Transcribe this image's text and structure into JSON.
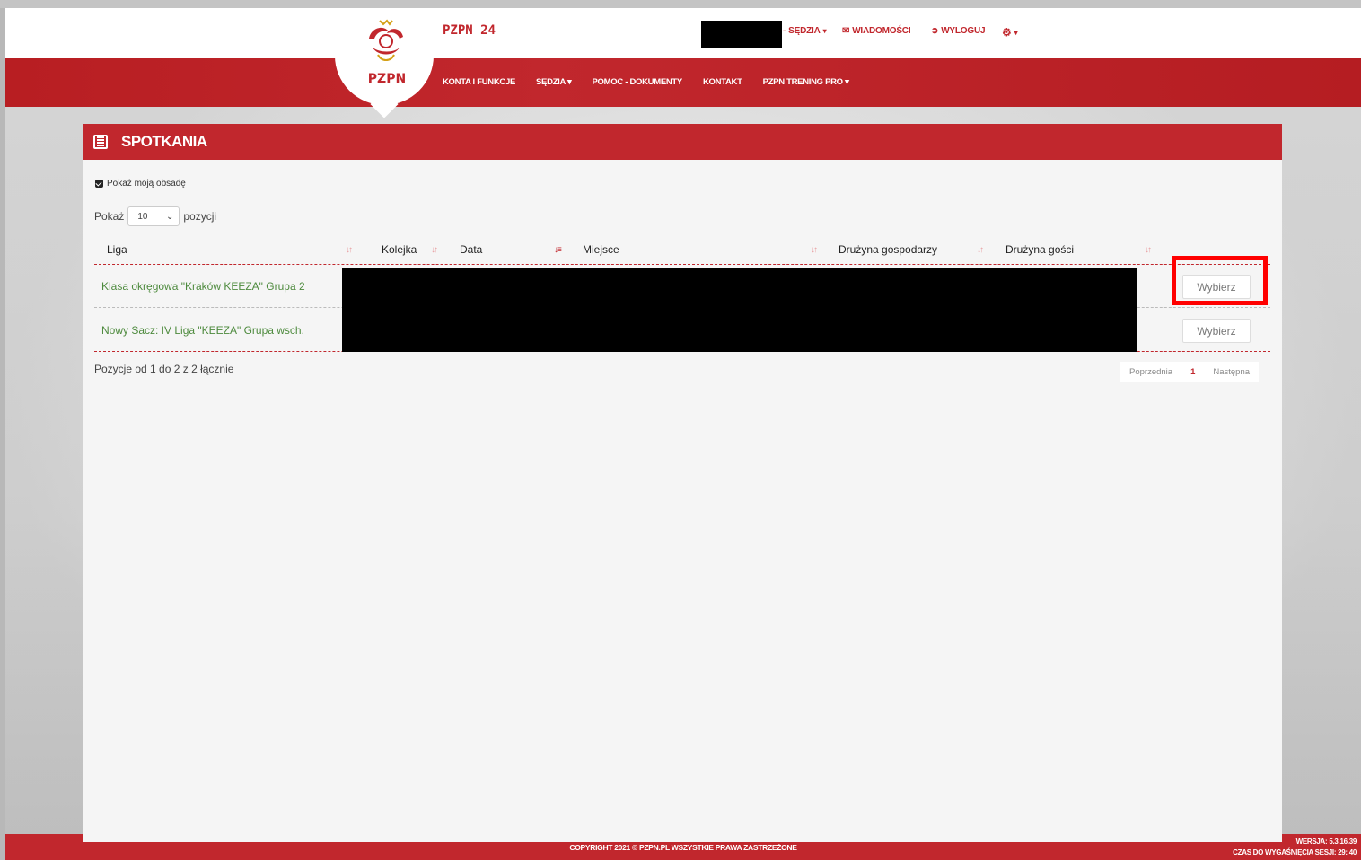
{
  "header": {
    "logo_text": "PZPN",
    "app_title": "PZPN 24",
    "top_nav": [
      {
        "label": "SĘDZIA",
        "icon": "caret-down-icon"
      },
      {
        "label": "WIADOMOŚCI",
        "icon": "envelope-icon"
      },
      {
        "label": "WYLOGUJ",
        "icon": "logout-icon"
      }
    ],
    "main_nav": [
      "KONTA I FUNKCJE",
      "SĘDZIA",
      "POMOC - DOKUMENTY",
      "KONTAKT",
      "PZPN TRENING PRO"
    ]
  },
  "panel": {
    "title": "SPOTKANIA",
    "checkbox_label": "Pokaż moją obsadę",
    "show_prefix": "Pokaż",
    "show_value": "10",
    "show_suffix": "pozycji",
    "columns": [
      "Liga",
      "Kolejka",
      "Data",
      "Miejsce",
      "Drużyna gospodarzy",
      "Drużyna gości"
    ],
    "rows": [
      {
        "league": "Klasa okręgowa \"Kraków KEEZA\" Grupa 2",
        "action": "Wybierz"
      },
      {
        "league": "Nowy Sacz: IV Liga \"KEEZA\" Grupa wsch.",
        "action": "Wybierz"
      }
    ],
    "info": "Pozycje od 1 do 2 z 2 łącznie",
    "pager": {
      "prev": "Poprzednia",
      "current": "1",
      "next": "Następna"
    }
  },
  "footer": {
    "copyright": "COPYRIGHT 2021 © PZPN.PL WSZYSTKIE PRAWA ZASTRZEŻONE",
    "version": "WERSJA: 5.3.16.39",
    "session": "CZAS DO WYGAŚNIĘCIA SESJI: 29: 40"
  },
  "colors": {
    "brand_red": "#c1272d",
    "link_green": "#4d8a3d",
    "highlight": "#ff0000"
  }
}
